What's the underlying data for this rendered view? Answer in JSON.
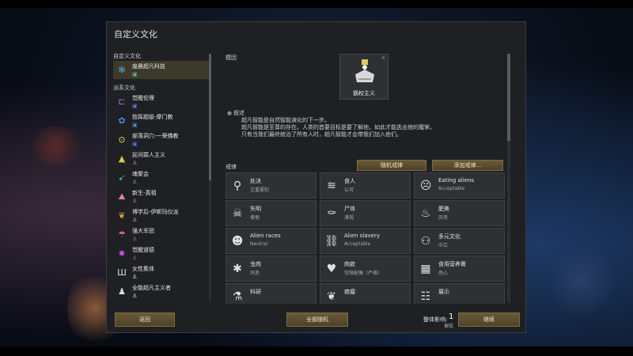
{
  "dialog": {
    "title": "自定义文化"
  },
  "left_panel": {
    "custom_header": "自定义文化",
    "custom_items": [
      {
        "name": "废晨超凡科技",
        "icon": "snowflake-icon",
        "color": "#5aa6e0",
        "badge": "square-badge-icon",
        "badge_color": "#5ab0a0"
      }
    ],
    "source_header": "派系文化",
    "source_items": [
      {
        "name": "觉醒伦理",
        "icon": "bracket-icon",
        "color": "#a080e0",
        "badge": "square-badge-icon",
        "badge_color": "#6070e0"
      },
      {
        "name": "指挥超级-摩门教",
        "icon": "flower-icon",
        "color": "#4a8ae0",
        "badge": "square-badge-icon",
        "badge_color": "#4a8ae0"
      },
      {
        "name": "部落洞穴-一荣佛教",
        "icon": "circle-dots-icon",
        "color": "#e0e060",
        "badge": "square-badge-icon",
        "badge_color": "#4a70e0"
      },
      {
        "name": "民间罪人主义",
        "icon": "triangle-icon",
        "color": "#e0c040",
        "badge": "person-badge-icon",
        "badge_color": "#d0a060"
      },
      {
        "name": "魂聚会",
        "icon": "arrow-icon",
        "color": "#40c080",
        "badge": "person-badge-icon",
        "badge_color": "#60c080"
      },
      {
        "name": "新生-真相",
        "icon": "mountain-icon",
        "color": "#e080a0",
        "badge": "person-badge-icon",
        "badge_color": "#d080a0"
      },
      {
        "name": "博学后-伊斯玛仪派",
        "icon": "wing-icon",
        "color": "#e0a040",
        "badge": "person-badge-icon",
        "badge_color": "#e0c060"
      },
      {
        "name": "强大军团",
        "icon": "fan-icon",
        "color": "#e06090",
        "badge": "person-badge-icon",
        "badge_color": "#c060b0"
      },
      {
        "name": "觉醒道德",
        "icon": "burst-icon",
        "color": "#c050e0",
        "badge": "person-badge-icon",
        "badge_color": "#c050e0"
      },
      {
        "name": "女性集体",
        "icon": "pillar-icon",
        "color": "#e0e0e0",
        "badge": "person-badge-icon",
        "badge_color": "#e0e0e0"
      },
      {
        "name": "全能超凡主义者",
        "icon": "pawn-icon",
        "color": "#e0e0e0",
        "badge": "person-badge-icon",
        "badge_color": "#e0e0e0"
      }
    ]
  },
  "meme": {
    "label": "模因",
    "name": "霸权主义",
    "icon": "hand-crown-icon"
  },
  "narrative": {
    "title": "叙述",
    "lines": [
      "超凡智能是自然智能演化的下一步。",
      "超凡智能是至尊的存在。人类的首要目标是要了解他，如此才能逃出他的魔掌。",
      "只有当我们最终统治了所有人时，超凡智能才会带我们加入他们。"
    ]
  },
  "precepts": {
    "label": "戒律",
    "random_button": "随机戒律",
    "add_button": "添加戒律...",
    "items": [
      {
        "name": "处决",
        "level": "注重罪犯",
        "icon": "noose-icon",
        "glyph": "⚲"
      },
      {
        "name": "食人",
        "level": "认可",
        "icon": "teeth-icon",
        "glyph": "≋"
      },
      {
        "name": "Eating aliens",
        "level": "Acceptable",
        "icon": "alien-food-icon",
        "glyph": "☹"
      },
      {
        "name": "失明",
        "level": "憎恨",
        "icon": "blind-skull-icon",
        "glyph": "☠"
      },
      {
        "name": "尸体",
        "level": "漠视",
        "icon": "corpse-icon",
        "glyph": "⚰"
      },
      {
        "name": "肥美",
        "level": "厌恶",
        "icon": "fat-icon",
        "glyph": "♨"
      },
      {
        "name": "Alien races",
        "level": "Neutral",
        "icon": "alien-head-icon",
        "glyph": "☻"
      },
      {
        "name": "Alien slavery",
        "level": "Acceptable",
        "icon": "slaves-icon",
        "glyph": "⛓"
      },
      {
        "name": "多元文化",
        "level": "中立",
        "icon": "culture-icon",
        "glyph": "⚇"
      },
      {
        "name": "虫肉",
        "level": "厌恶",
        "icon": "bug-icon",
        "glyph": "✱"
      },
      {
        "name": "肉欲",
        "level": "仅限配偶（严格）",
        "icon": "bed-heart-icon",
        "glyph": "♥"
      },
      {
        "name": "食用营养膏",
        "level": "恶心",
        "icon": "nutrient-icon",
        "glyph": "▦"
      },
      {
        "name": "科研",
        "level": "",
        "icon": "flask-icon",
        "glyph": "⚗"
      },
      {
        "name": "癌瘤",
        "level": "",
        "icon": "tumor-icon",
        "glyph": "❦"
      },
      {
        "name": "展示",
        "level": "",
        "icon": "display-icon",
        "glyph": "☷"
      }
    ]
  },
  "footer": {
    "back_button": "返回",
    "randomize_button": "全部随机",
    "impact_label": "整体影响:",
    "impact_value": "1",
    "impact_sub": "偏低",
    "continue_button": "继续"
  },
  "colors": {
    "dialog_bg": "#1e2023",
    "button_gold": "#6a5a38",
    "selected_row": "#3d3a2c"
  }
}
